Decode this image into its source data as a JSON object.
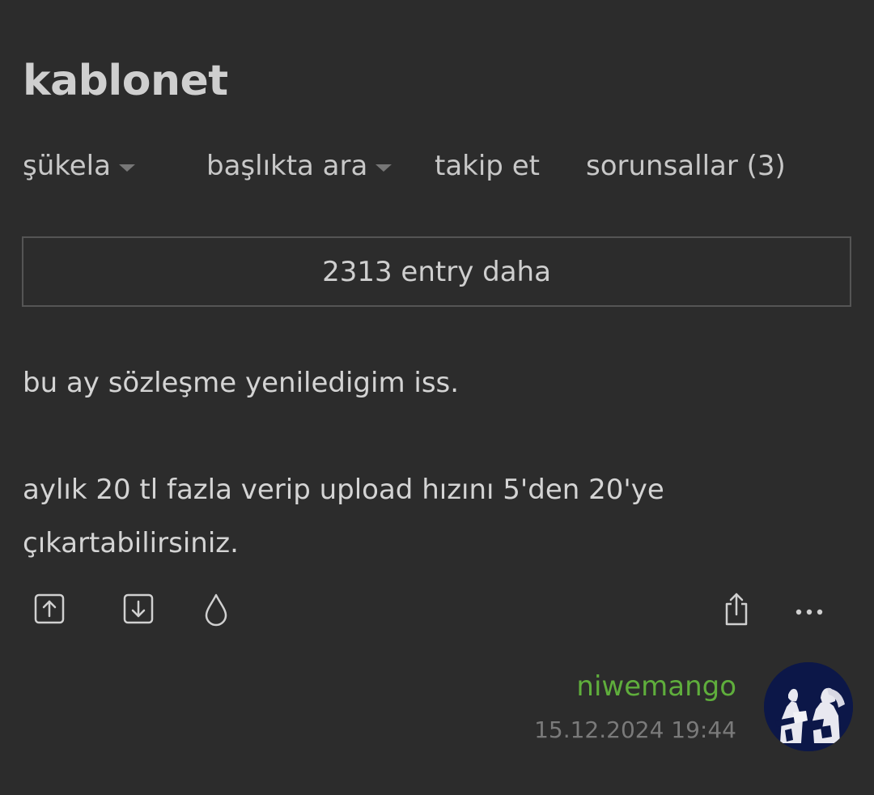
{
  "topic": {
    "title": "kablonet"
  },
  "nav": {
    "sort_label": "şükela",
    "search_label": "başlıkta ara",
    "follow_label": "takip et",
    "questions_label": "sorunsallar (3)"
  },
  "more_entries": {
    "label": "2313 entry daha"
  },
  "entry": {
    "paragraph_1": "bu ay sözleşme yeniledigim iss.",
    "paragraph_2": "aylık 20 tl fazla verip upload hızını 5'den 20'ye çıkartabilirsiniz."
  },
  "entry_actions": {
    "icons": [
      "upvote-icon",
      "downvote-icon",
      "drop-icon",
      "share-icon",
      "more-icon"
    ]
  },
  "author": {
    "username": "niwemango",
    "timestamp": "15.12.2024 19:44"
  },
  "colors": {
    "background": "#2c2c2c",
    "text": "#d4d4d4",
    "username": "#5fae3c",
    "muted": "#7a7a7a",
    "border": "#555555"
  }
}
